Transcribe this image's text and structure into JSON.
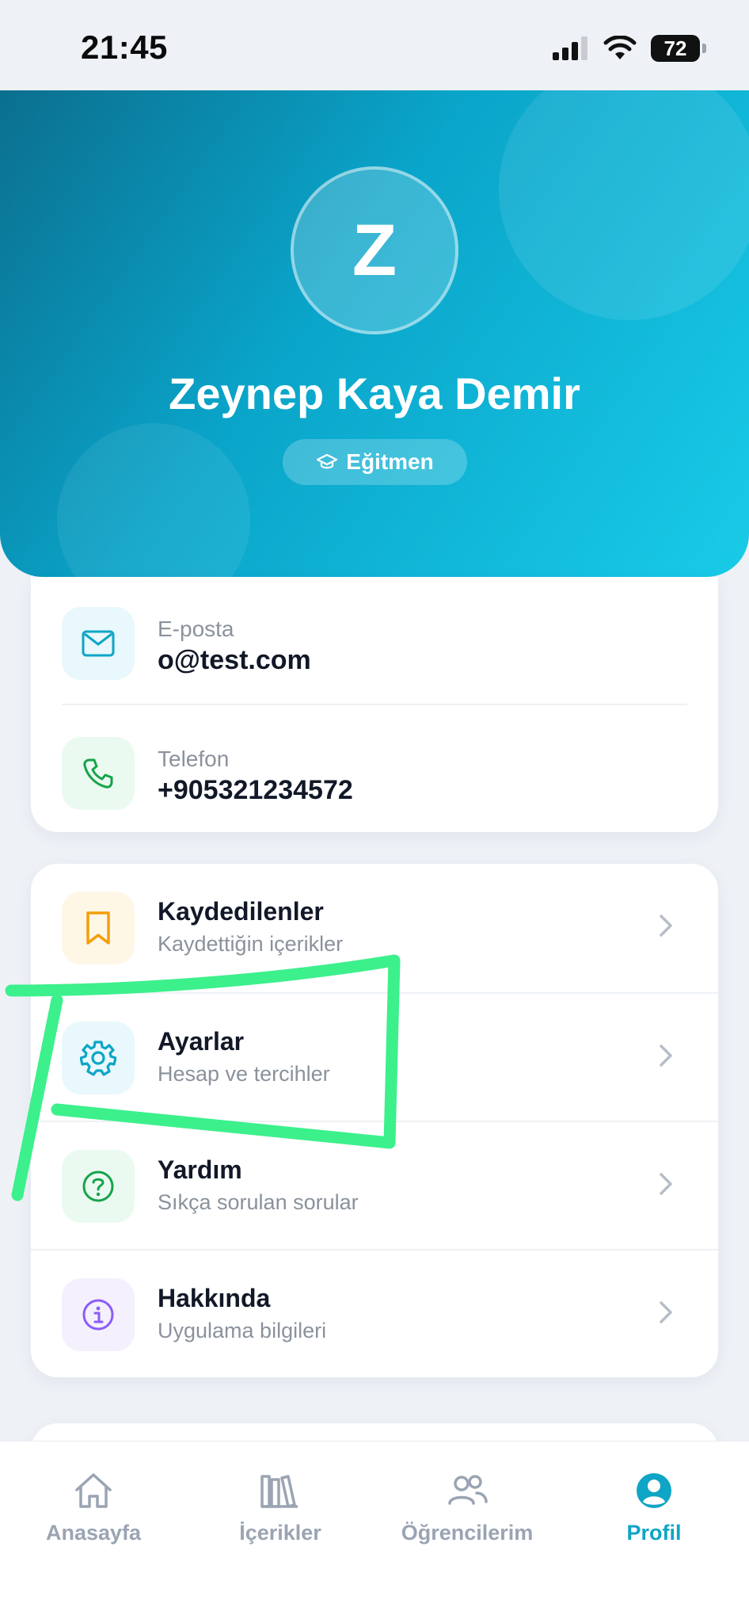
{
  "status_bar": {
    "time": "21:45",
    "battery": "72"
  },
  "profile": {
    "avatar_initial": "Z",
    "name": "Zeynep Kaya Demir",
    "role": "Eğitmen"
  },
  "contact": [
    {
      "label": "E-posta",
      "value": "o@test.com",
      "icon": "mail-icon"
    },
    {
      "label": "Telefon",
      "value": "+905321234572",
      "icon": "phone-icon"
    }
  ],
  "menu": [
    {
      "title": "Kaydedilenler",
      "subtitle": "Kaydettiğin içerikler",
      "icon": "bookmark-icon",
      "color": "#f59e0b"
    },
    {
      "title": "Ayarlar",
      "subtitle": "Hesap ve tercihler",
      "icon": "gear-icon",
      "color": "#0ea5c6"
    },
    {
      "title": "Yardım",
      "subtitle": "Sıkça sorulan sorular",
      "icon": "question-circle-icon",
      "color": "#16a34a"
    },
    {
      "title": "Hakkında",
      "subtitle": "Uygulama bilgileri",
      "icon": "info-circle-icon",
      "color": "#8b5cf6"
    }
  ],
  "bottom_nav": [
    {
      "label": "Anasayfa",
      "icon": "home-icon",
      "active": false
    },
    {
      "label": "İçerikler",
      "icon": "library-icon",
      "active": false
    },
    {
      "label": "Öğrencilerim",
      "icon": "users-icon",
      "active": false
    },
    {
      "label": "Profil",
      "icon": "profile-icon",
      "active": true
    }
  ],
  "colors": {
    "accent": "#0ea5c6",
    "annotation": "#3cf08c"
  }
}
